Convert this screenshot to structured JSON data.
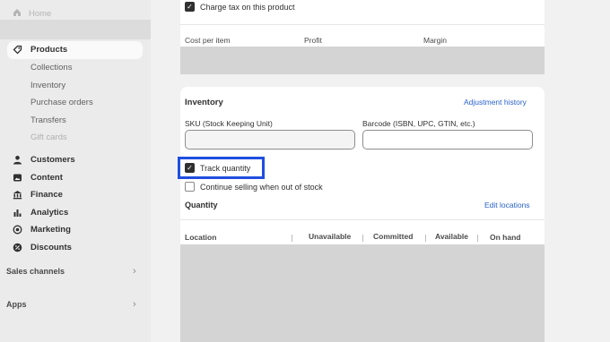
{
  "sidebar": {
    "home": "Home",
    "products": "Products",
    "product_sub": [
      "Collections",
      "Inventory",
      "Purchase orders",
      "Transfers",
      "Gift cards"
    ],
    "main_items": [
      "Customers",
      "Content",
      "Finance",
      "Analytics",
      "Marketing",
      "Discounts"
    ],
    "sales_channels": "Sales channels",
    "apps": "Apps"
  },
  "pricing": {
    "charge_tax": "Charge tax on this product",
    "charge_tax_checked": true,
    "columns": [
      "Cost per item",
      "Profit",
      "Margin"
    ]
  },
  "inventory": {
    "title": "Inventory",
    "adjustment_link": "Adjustment history",
    "sku_label": "SKU (Stock Keeping Unit)",
    "sku_value": "",
    "barcode_label": "Barcode (ISBN, UPC, GTIN, etc.)",
    "barcode_value": "",
    "track_quantity": "Track quantity",
    "track_quantity_checked": true,
    "continue_selling": "Continue selling when out of stock",
    "continue_selling_checked": false,
    "quantity_title": "Quantity",
    "edit_locations": "Edit locations",
    "columns": [
      "Location",
      "Unavailable",
      "Committed",
      "Available",
      "On hand"
    ]
  },
  "colors": {
    "highlight": "#1f4ee0",
    "link": "#2a62cc",
    "sidebar_bg": "#ebebeb"
  }
}
